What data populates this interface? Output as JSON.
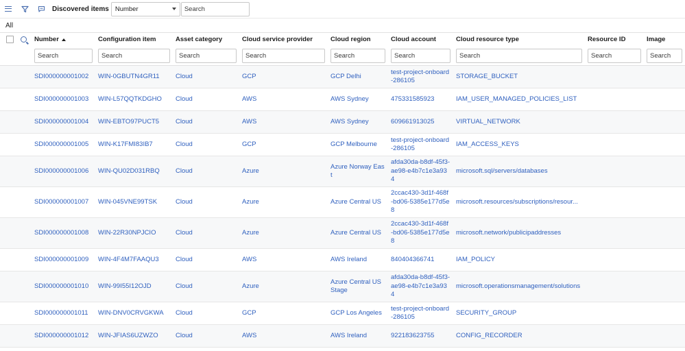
{
  "toolbar": {
    "menu_icon": "hamburger-menu-icon",
    "filter_icon": "funnel-icon",
    "chat_icon": "speech-bubble-icon",
    "title": "Discovered items",
    "field_select": "Number",
    "search_placeholder": "Search"
  },
  "breadcrumb": "All",
  "columns": [
    {
      "label": "Number",
      "sorted": "ascending"
    },
    {
      "label": "Configuration item"
    },
    {
      "label": "Asset category"
    },
    {
      "label": "Cloud service provider"
    },
    {
      "label": "Cloud region"
    },
    {
      "label": "Cloud account"
    },
    {
      "label": "Cloud resource type"
    },
    {
      "label": "Resource ID"
    },
    {
      "label": "Image"
    }
  ],
  "column_search_placeholder": "Search",
  "rows": [
    {
      "number": "SDI000000001002",
      "ci": "WIN-0GBUTN4GR11",
      "category": "Cloud",
      "provider": "GCP",
      "region": "GCP Delhi",
      "account": "test-project-onboard-286105",
      "type": "STORAGE_BUCKET",
      "resource_id": "",
      "image": ""
    },
    {
      "number": "SDI000000001003",
      "ci": "WIN-L57QQTKDGHO",
      "category": "Cloud",
      "provider": "AWS",
      "region": "AWS Sydney",
      "account": "475331585923",
      "type": "IAM_USER_MANAGED_POLICIES_LIST",
      "resource_id": "",
      "image": ""
    },
    {
      "number": "SDI000000001004",
      "ci": "WIN-EBTO97PUCT5",
      "category": "Cloud",
      "provider": "AWS",
      "region": "AWS Sydney",
      "account": "609661913025",
      "type": "VIRTUAL_NETWORK",
      "resource_id": "",
      "image": ""
    },
    {
      "number": "SDI000000001005",
      "ci": "WIN-K17FMI83IB7",
      "category": "Cloud",
      "provider": "GCP",
      "region": "GCP Melbourne",
      "account": "test-project-onboard-286105",
      "type": "IAM_ACCESS_KEYS",
      "resource_id": "",
      "image": ""
    },
    {
      "number": "SDI000000001006",
      "ci": "WIN-QU02D031RBQ",
      "category": "Cloud",
      "provider": "Azure",
      "region": "Azure Norway East",
      "account": "afda30da-b8df-45f3-ae98-e4b7c1e3a934",
      "type": "microsoft.sql/servers/databases",
      "resource_id": "",
      "image": ""
    },
    {
      "number": "SDI000000001007",
      "ci": "WIN-045VNE99TSK",
      "category": "Cloud",
      "provider": "Azure",
      "region": "Azure Central US",
      "account": "2ccac430-3d1f-468f-bd06-5385e177d5e8",
      "type": "microsoft.resources/subscriptions/resour...",
      "resource_id": "",
      "image": ""
    },
    {
      "number": "SDI000000001008",
      "ci": "WIN-22R30NPJCIO",
      "category": "Cloud",
      "provider": "Azure",
      "region": "Azure Central US",
      "account": "2ccac430-3d1f-468f-bd06-5385e177d5e8",
      "type": "microsoft.network/publicipaddresses",
      "resource_id": "",
      "image": ""
    },
    {
      "number": "SDI000000001009",
      "ci": "WIN-4F4M7FAAQU3",
      "category": "Cloud",
      "provider": "AWS",
      "region": "AWS Ireland",
      "account": "840404366741",
      "type": "IAM_POLICY",
      "resource_id": "",
      "image": ""
    },
    {
      "number": "SDI000000001010",
      "ci": "WIN-99I55I12OJD",
      "category": "Cloud",
      "provider": "Azure",
      "region": "Azure Central US Stage",
      "account": "afda30da-b8df-45f3-ae98-e4b7c1e3a934",
      "type": "microsoft.operationsmanagement/solutions",
      "resource_id": "",
      "image": ""
    },
    {
      "number": "SDI000000001011",
      "ci": "WIN-DNV0CRVGKWA",
      "category": "Cloud",
      "provider": "GCP",
      "region": "GCP Los Angeles",
      "account": "test-project-onboard-286105",
      "type": "SECURITY_GROUP",
      "resource_id": "",
      "image": ""
    },
    {
      "number": "SDI000000001012",
      "ci": "WIN-JFIAS6UZWZO",
      "category": "Cloud",
      "provider": "AWS",
      "region": "AWS Ireland",
      "account": "922183623755",
      "type": "CONFIG_RECORDER",
      "resource_id": "",
      "image": ""
    }
  ]
}
